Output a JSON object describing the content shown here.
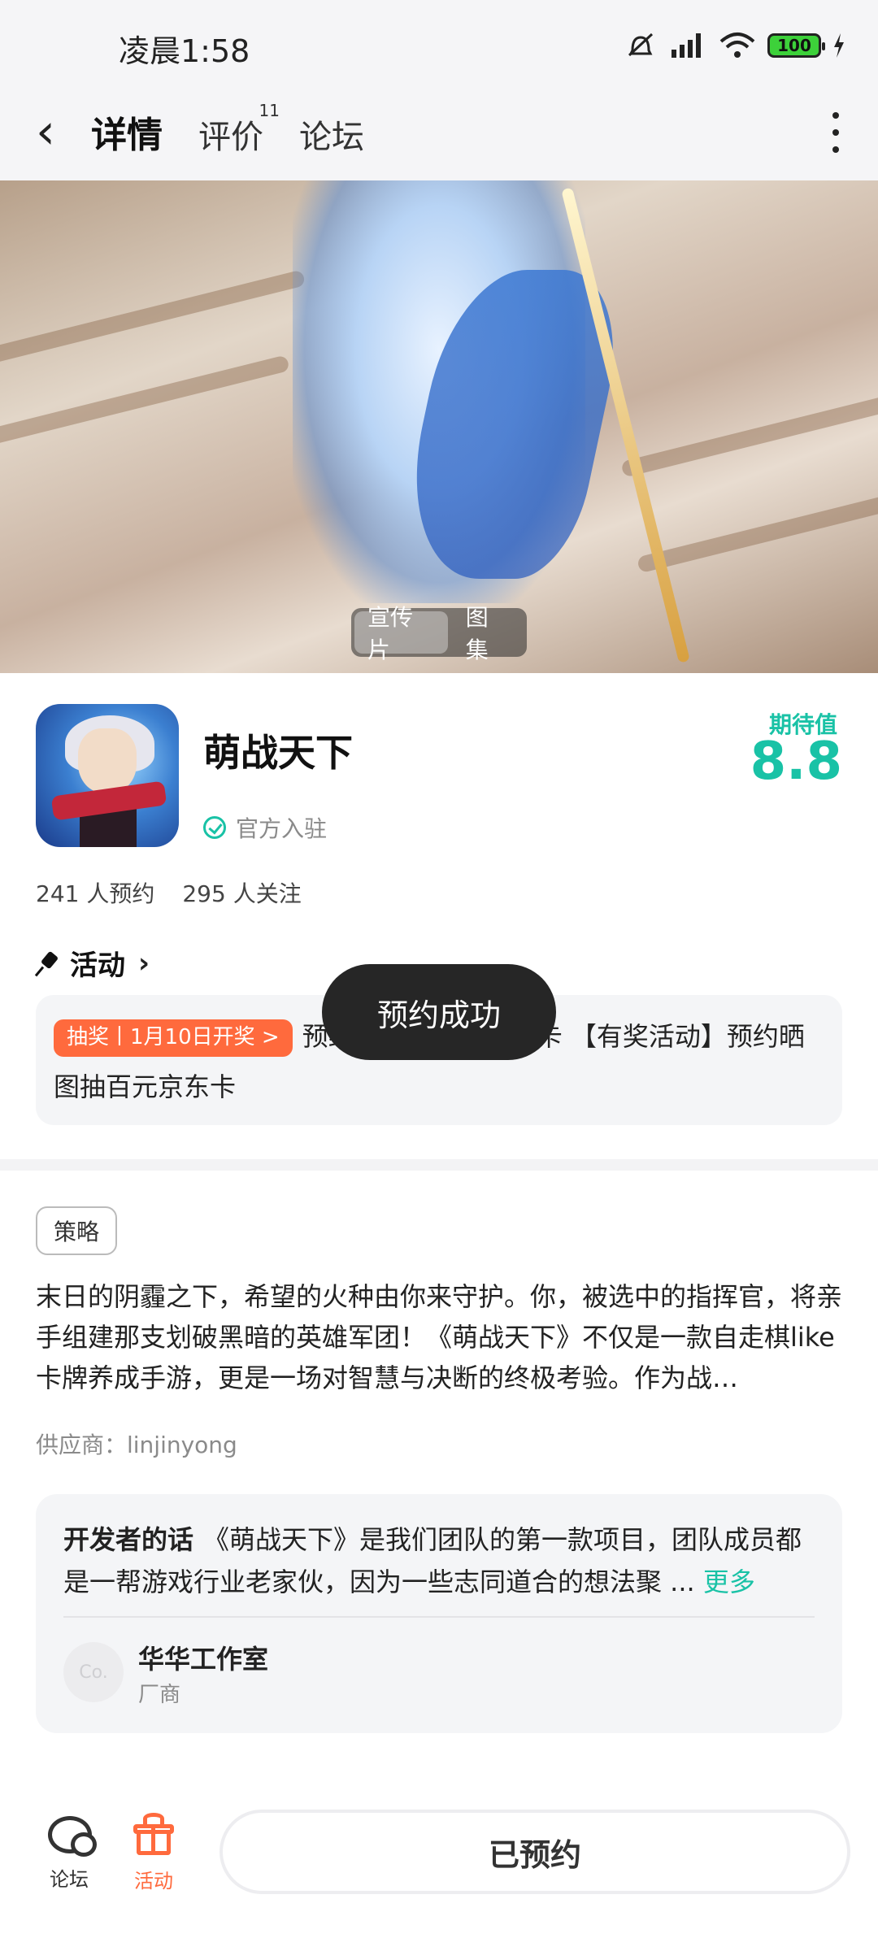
{
  "status_bar": {
    "time": "凌晨1:58",
    "battery": "100"
  },
  "nav": {
    "tabs": [
      {
        "label": "详情",
        "active": true
      },
      {
        "label": "评价",
        "badge": "11"
      },
      {
        "label": "论坛"
      }
    ]
  },
  "hero": {
    "media_options": [
      "宣传片",
      "图集"
    ],
    "selected": "宣传片"
  },
  "app": {
    "name": "萌战天下",
    "official_label": "官方入驻",
    "expect_label": "期待值",
    "expect_score": "8.8",
    "reservations": "241 人预约",
    "followers": "295 人关注"
  },
  "activity": {
    "header": "活动",
    "tag": "抽奖丨1月10日开奖 >",
    "text": "预约晒图抽百元京东卡 【有奖活动】预约晒图抽百元京东卡"
  },
  "toast": "预约成功",
  "description": {
    "strategy_label": "策略",
    "text": "末日的阴霾之下，希望的火种由你来守护。你，被选中的指挥官，将亲手组建那支划破黑暗的英雄军团！《萌战天下》不仅是一款自走棋like卡牌养成手游，更是一场对智慧与决断的终极考验。作为战…",
    "supplier": "供应商：linjinyong"
  },
  "developer": {
    "heading": "开发者的话",
    "text": "《萌战天下》是我们团队的第一款项目，团队成员都是一帮游戏行业老家伙，因为一些志同道合的想法聚 ...",
    "more": "更多",
    "avatar_text": "Co.",
    "name": "华华工作室",
    "role": "厂商"
  },
  "bottom_bar": {
    "forum": "论坛",
    "activity": "活动",
    "reserve_button": "已预约"
  },
  "colors": {
    "accent": "#19c2a6",
    "orange": "#ff6a3d"
  }
}
